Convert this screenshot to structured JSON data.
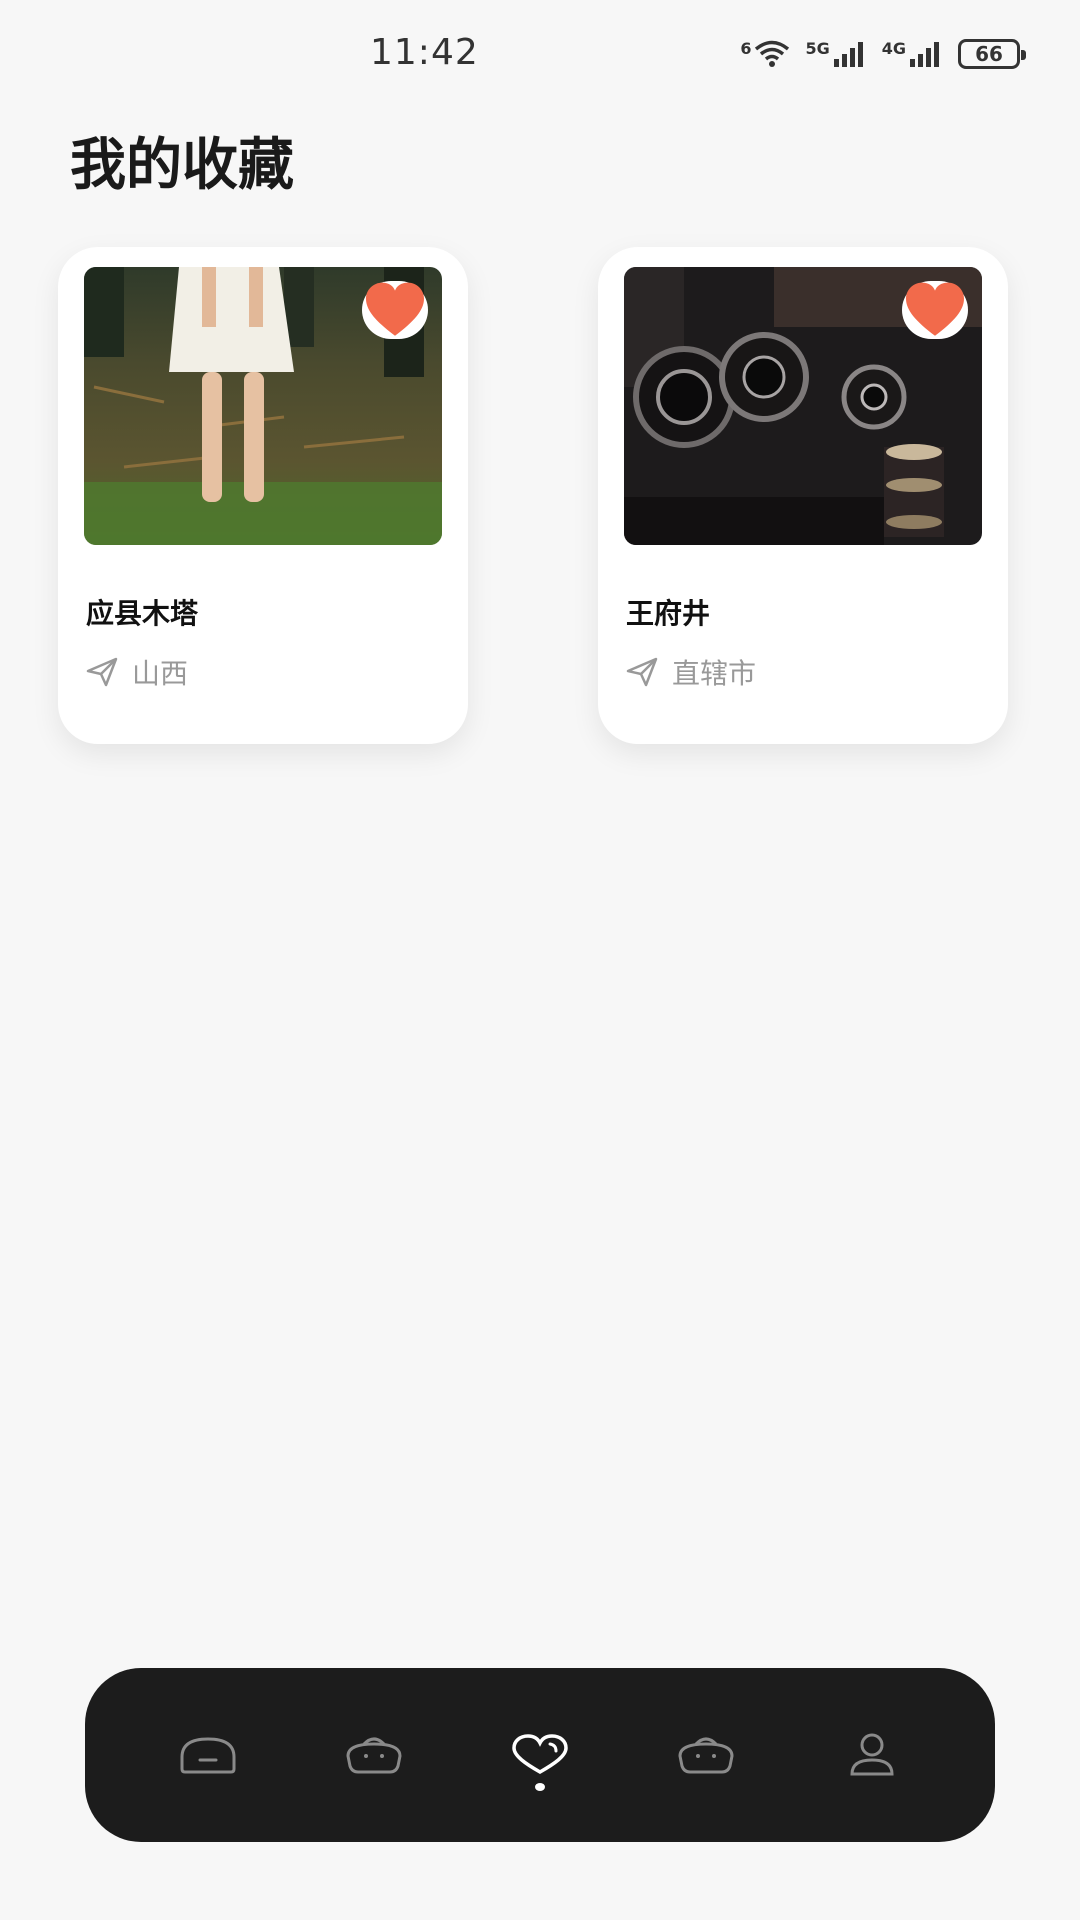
{
  "status_bar": {
    "time": "11:42",
    "wifi_label": "6",
    "signal1_label": "5G",
    "signal2_label": "4G",
    "battery": "66"
  },
  "page": {
    "title": "我的收藏"
  },
  "favorites": [
    {
      "name": "应县木塔",
      "location": "山西",
      "icon": "heart-icon"
    },
    {
      "name": "王府井",
      "location": "直辖市",
      "icon": "heart-icon"
    }
  ],
  "nav": {
    "items": [
      {
        "icon": "home-icon",
        "active": false
      },
      {
        "icon": "basket-icon",
        "active": false
      },
      {
        "icon": "heart-icon",
        "active": true
      },
      {
        "icon": "basket-icon",
        "active": false
      },
      {
        "icon": "profile-icon",
        "active": false
      }
    ]
  },
  "colors": {
    "accent": "#f26a4b",
    "nav_bg": "#1c1c1c",
    "background": "#f7f7f7"
  }
}
